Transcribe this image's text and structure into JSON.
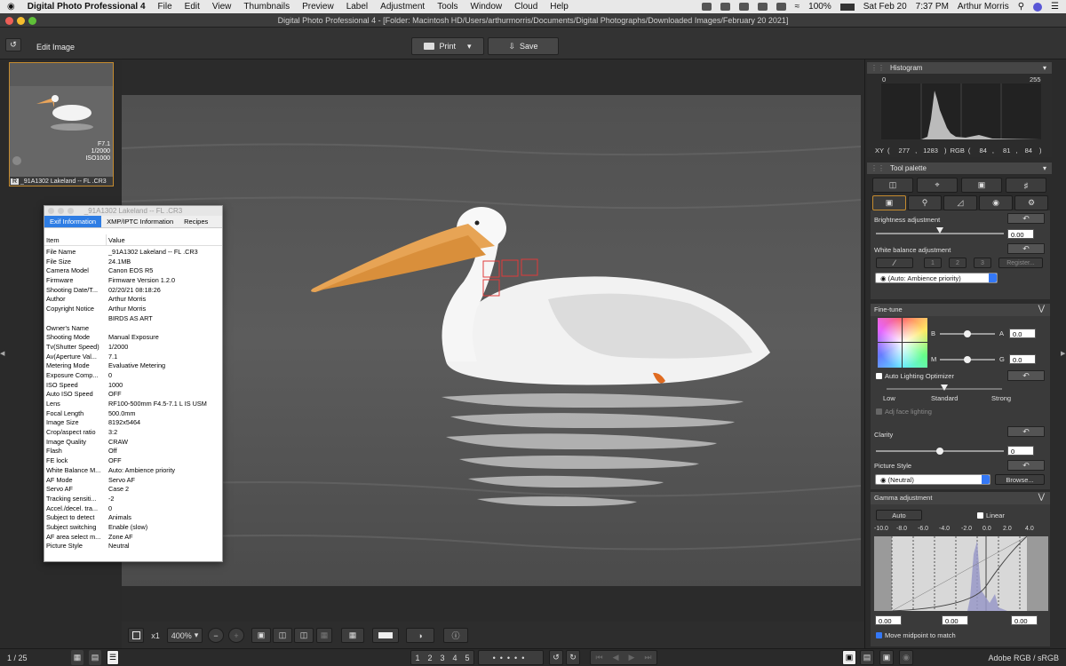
{
  "menubar": {
    "apple": "",
    "app_name": "Digital Photo Professional 4",
    "items": [
      "File",
      "Edit",
      "View",
      "Thumbnails",
      "Preview",
      "Label",
      "Adjustment",
      "Tools",
      "Window",
      "Cloud",
      "Help"
    ],
    "battery": "100%",
    "date": "Sat Feb 20",
    "time": "7:37 PM",
    "user": "Arthur Morris"
  },
  "window": {
    "title": "Digital Photo Professional 4 - [Folder: Macintosh HD/Users/arthurmorris/Documents/Digital Photographs/Downloaded Images/February 20 2021]"
  },
  "toolbar": {
    "mode": "Edit Image",
    "print": "Print",
    "save": "Save"
  },
  "thumbnail": {
    "aperture": "F7.1",
    "shutter": "1/2000",
    "iso": "ISO1000",
    "badge": "R",
    "filename": "_91A1302  Lakeland -- FL .CR3"
  },
  "exif": {
    "title": "_91A1302  Lakeland -- FL .CR3",
    "tabs": [
      "Exif Information",
      "XMP/IPTC Information",
      "Recipes"
    ],
    "col_item": "Item",
    "col_value": "Value",
    "rows": [
      [
        "File Name",
        "_91A1302  Lakeland -- FL .CR3"
      ],
      [
        "File Size",
        "24.1MB"
      ],
      [
        "Camera Model",
        "Canon EOS R5"
      ],
      [
        "Firmware",
        "Firmware Version 1.2.0"
      ],
      [
        "Shooting Date/T...",
        "02/20/21 08:18:26"
      ],
      [
        "Author",
        "Arthur Morris"
      ],
      [
        "Copyright Notice",
        "Arthur Morris"
      ],
      [
        "",
        "BIRDS AS ART"
      ],
      [
        "Owner's Name",
        ""
      ],
      [
        "Shooting Mode",
        "Manual Exposure"
      ],
      [
        "Tv(Shutter Speed)",
        "1/2000"
      ],
      [
        "Av(Aperture Val...",
        "7.1"
      ],
      [
        "Metering Mode",
        "Evaluative Metering"
      ],
      [
        "Exposure Comp...",
        "0"
      ],
      [
        "ISO Speed",
        "1000"
      ],
      [
        "Auto ISO Speed",
        "OFF"
      ],
      [
        "Lens",
        "RF100-500mm F4.5-7.1 L IS USM"
      ],
      [
        "Focal Length",
        "500.0mm"
      ],
      [
        "Image Size",
        "8192x5464"
      ],
      [
        "Crop/aspect ratio",
        "3:2"
      ],
      [
        "Image Quality",
        "CRAW"
      ],
      [
        "Flash",
        "Off"
      ],
      [
        "FE lock",
        "OFF"
      ],
      [
        "White Balance M...",
        "Auto: Ambience priority"
      ],
      [
        "AF Mode",
        "Servo AF"
      ],
      [
        "Servo AF",
        "Case 2"
      ],
      [
        "Tracking sensiti...",
        "-2"
      ],
      [
        "Accel./decel. tra...",
        "0"
      ],
      [
        "Subject to detect",
        "Animals"
      ],
      [
        "Subject switching",
        "Enable (slow)"
      ],
      [
        "AF area select m...",
        "Zone AF"
      ],
      [
        "Picture Style",
        "Neutral"
      ]
    ]
  },
  "viewbar": {
    "zoom_x1": "x1",
    "zoom": "400%"
  },
  "status": {
    "count": "1 / 25",
    "ratings": [
      "1",
      "2",
      "3",
      "4",
      "5"
    ],
    "colorspace": "Adobe RGB / sRGB"
  },
  "histogram": {
    "title": "Histogram",
    "min": "0",
    "max": "255",
    "xy_label": "XY (",
    "x": "277",
    "y": "1283",
    "rgb_label": ") RGB (",
    "r": "84",
    "g": "81",
    "b": "84",
    "close": ")"
  },
  "tool_palette": {
    "title": "Tool palette",
    "brightness": {
      "label": "Brightness adjustment",
      "value": "0.00",
      "level": 0.5
    },
    "white_balance": {
      "label": "White balance adjustment",
      "presets": [
        "1",
        "2",
        "3"
      ],
      "register": "Register...",
      "mode": "(Auto: Ambience priority)"
    },
    "fine_tune": {
      "label": "Fine-tune",
      "b": "B",
      "a": "A",
      "m": "M",
      "g": "G",
      "a_value": "0.0",
      "g_value": "0.0"
    },
    "alo": {
      "label": "Auto Lighting Optimizer",
      "low": "Low",
      "standard": "Standard",
      "strong": "Strong",
      "face": "Adj face lighting"
    },
    "clarity": {
      "label": "Clarity",
      "value": "0",
      "level": 0.5
    },
    "picture_style": {
      "label": "Picture Style",
      "value": "(Neutral)",
      "browse": "Browse..."
    },
    "gamma": {
      "label": "Gamma adjustment",
      "auto": "Auto",
      "linear": "Linear",
      "ticks": [
        "-10.0",
        "-8.0",
        "-6.0",
        "-4.0",
        "-2.0",
        "0.0",
        "2.0",
        "4.0"
      ],
      "v1": "0.00",
      "v2": "0.00",
      "v3": "0.00",
      "midpoint": "Move midpoint to match"
    }
  }
}
